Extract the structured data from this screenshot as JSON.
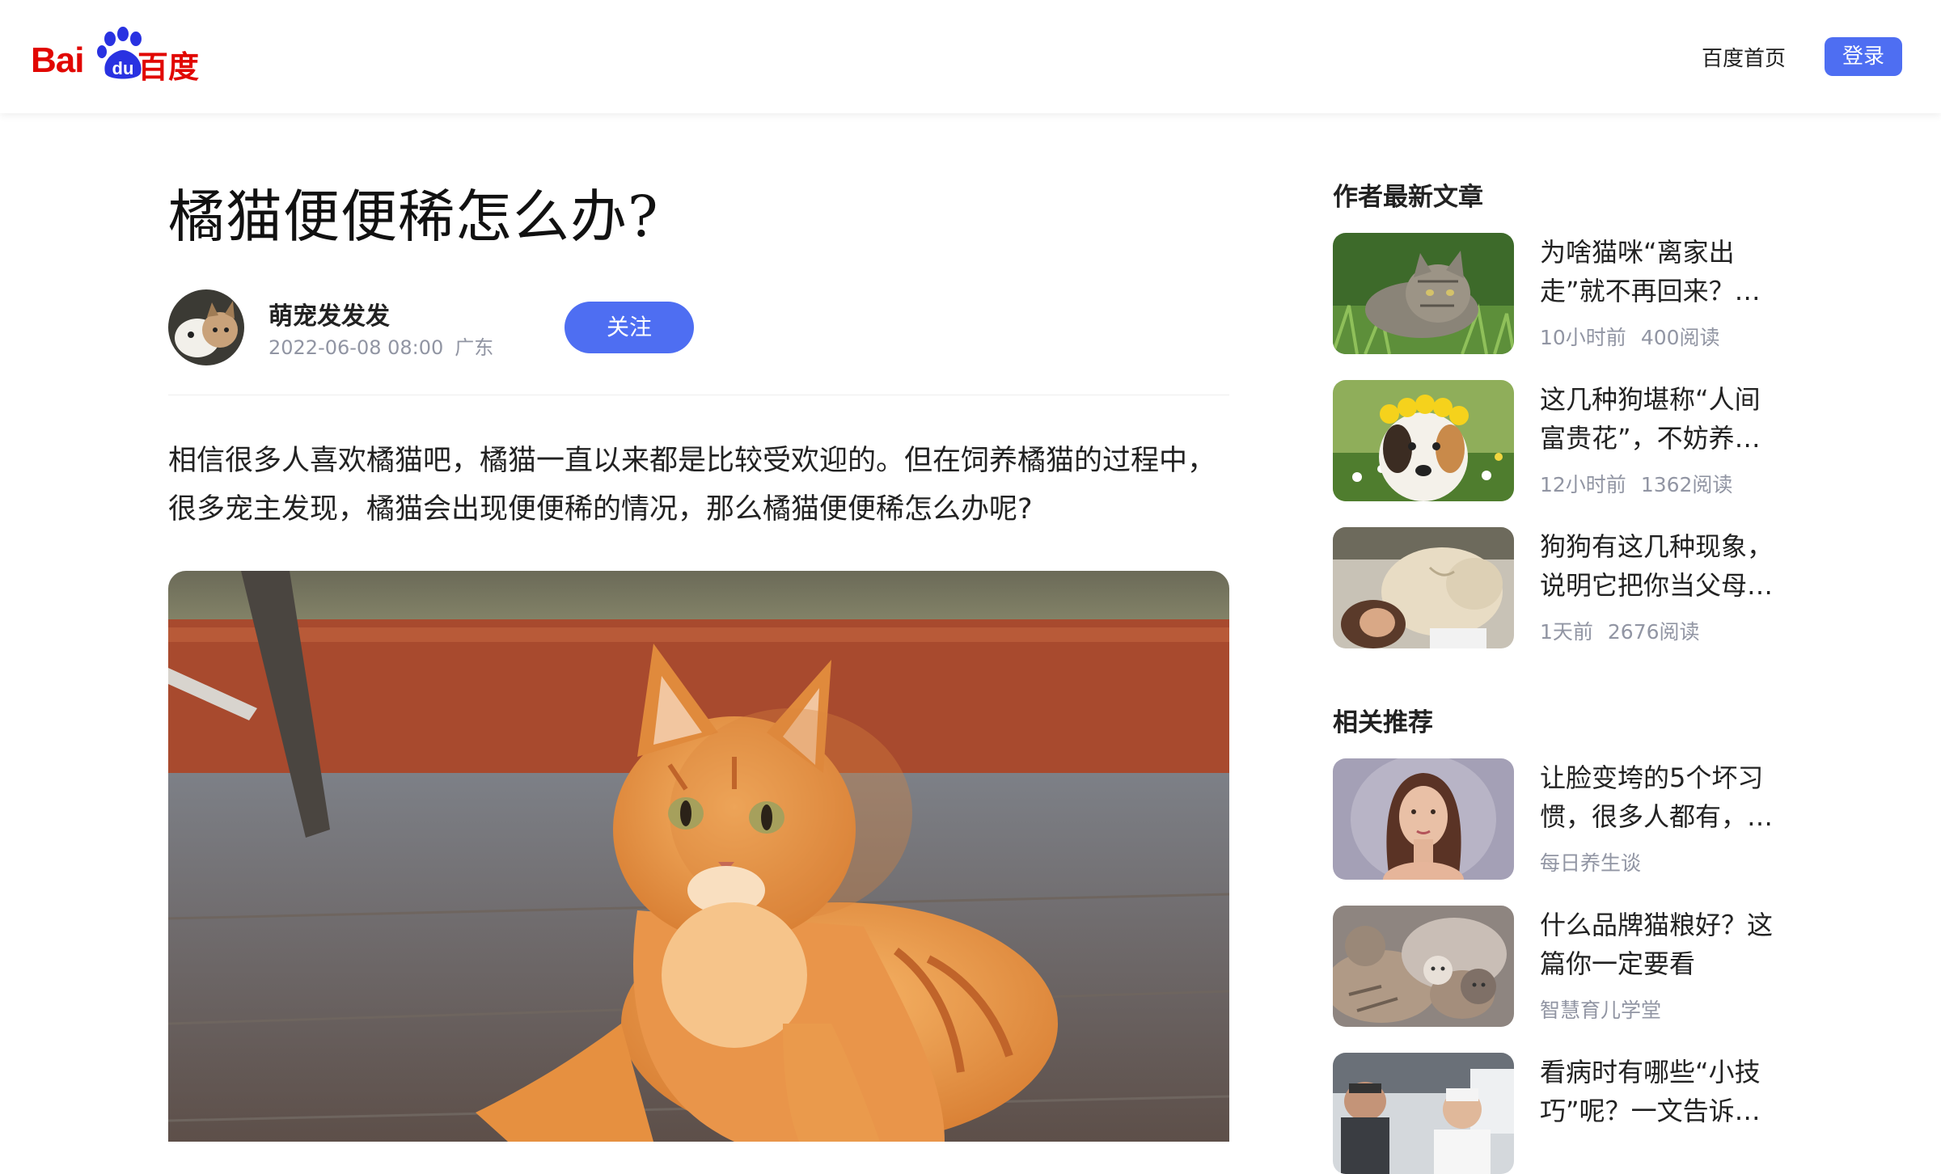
{
  "header": {
    "logo_latin_1": "Bai",
    "logo_latin_2": "du",
    "logo_cn": "百度",
    "nav_home": "百度首页",
    "login_label": "登录",
    "accent_color": "#4e6ef2",
    "logo_color": "#e10601"
  },
  "article": {
    "title": "橘猫便便稀怎么办?",
    "author": {
      "name": "萌宠发发发",
      "datetime": "2022-06-08 08:00",
      "location": "广东"
    },
    "follow_label": "关注",
    "body": "相信很多人喜欢橘猫吧，橘猫一直以来都是比较受欢迎的。但在饲养橘猫的过程中，很多宠主发现，橘猫会出现便便稀的情况，那么橘猫便便稀怎么办呢?"
  },
  "sidebar": {
    "author_latest_title": "作者最新文章",
    "author_latest": [
      {
        "title": "为啥猫咪“离家出走”就不再回来？…",
        "time": "10小时前",
        "reads": "400阅读",
        "thumb": "tabby-cat-in-grass"
      },
      {
        "title": "这几种狗堪称“人间富贵花”，不妨养…",
        "time": "12小时前",
        "reads": "1362阅读",
        "thumb": "dog-with-flower-crown"
      },
      {
        "title": "狗狗有这几种现象，说明它把你当父母…",
        "time": "1天前",
        "reads": "2676阅读",
        "thumb": "pug-and-person"
      }
    ],
    "related_title": "相关推荐",
    "related": [
      {
        "title": "让脸变垮的5个坏习惯，很多人都有，…",
        "source": "每日养生谈",
        "thumb": "woman-portrait"
      },
      {
        "title": "什么品牌猫粮好？这篇你一定要看",
        "source": "智慧育儿学堂",
        "thumb": "kittens-pile"
      },
      {
        "title": "看病时有哪些“小技巧”呢？一文告诉…",
        "source": "",
        "thumb": "doctor-and-patient"
      }
    ]
  }
}
